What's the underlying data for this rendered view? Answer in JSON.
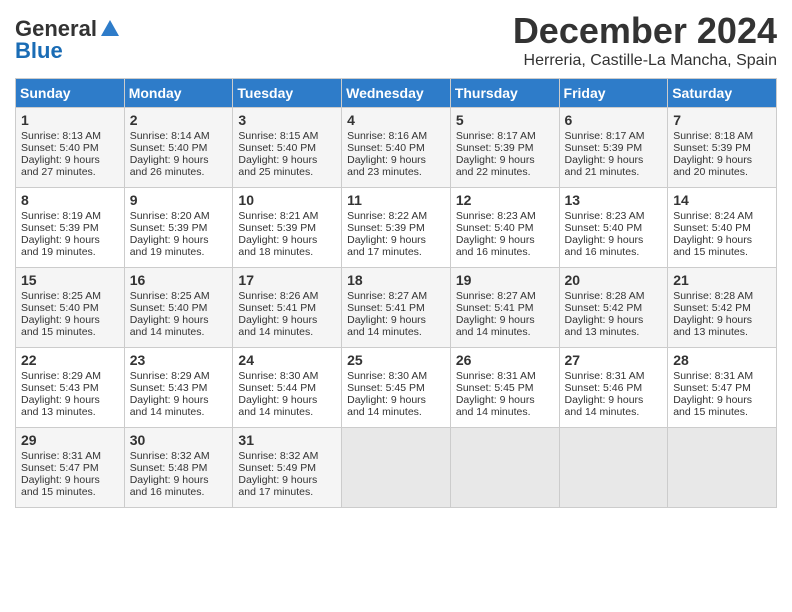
{
  "header": {
    "logo_general": "General",
    "logo_blue": "Blue",
    "title": "December 2024",
    "subtitle": "Herreria, Castille-La Mancha, Spain"
  },
  "columns": [
    "Sunday",
    "Monday",
    "Tuesday",
    "Wednesday",
    "Thursday",
    "Friday",
    "Saturday"
  ],
  "weeks": [
    [
      {
        "day": "1",
        "sunrise": "Sunrise: 8:13 AM",
        "sunset": "Sunset: 5:40 PM",
        "daylight": "Daylight: 9 hours and 27 minutes."
      },
      {
        "day": "2",
        "sunrise": "Sunrise: 8:14 AM",
        "sunset": "Sunset: 5:40 PM",
        "daylight": "Daylight: 9 hours and 26 minutes."
      },
      {
        "day": "3",
        "sunrise": "Sunrise: 8:15 AM",
        "sunset": "Sunset: 5:40 PM",
        "daylight": "Daylight: 9 hours and 25 minutes."
      },
      {
        "day": "4",
        "sunrise": "Sunrise: 8:16 AM",
        "sunset": "Sunset: 5:40 PM",
        "daylight": "Daylight: 9 hours and 23 minutes."
      },
      {
        "day": "5",
        "sunrise": "Sunrise: 8:17 AM",
        "sunset": "Sunset: 5:39 PM",
        "daylight": "Daylight: 9 hours and 22 minutes."
      },
      {
        "day": "6",
        "sunrise": "Sunrise: 8:17 AM",
        "sunset": "Sunset: 5:39 PM",
        "daylight": "Daylight: 9 hours and 21 minutes."
      },
      {
        "day": "7",
        "sunrise": "Sunrise: 8:18 AM",
        "sunset": "Sunset: 5:39 PM",
        "daylight": "Daylight: 9 hours and 20 minutes."
      }
    ],
    [
      {
        "day": "8",
        "sunrise": "Sunrise: 8:19 AM",
        "sunset": "Sunset: 5:39 PM",
        "daylight": "Daylight: 9 hours and 19 minutes."
      },
      {
        "day": "9",
        "sunrise": "Sunrise: 8:20 AM",
        "sunset": "Sunset: 5:39 PM",
        "daylight": "Daylight: 9 hours and 19 minutes."
      },
      {
        "day": "10",
        "sunrise": "Sunrise: 8:21 AM",
        "sunset": "Sunset: 5:39 PM",
        "daylight": "Daylight: 9 hours and 18 minutes."
      },
      {
        "day": "11",
        "sunrise": "Sunrise: 8:22 AM",
        "sunset": "Sunset: 5:39 PM",
        "daylight": "Daylight: 9 hours and 17 minutes."
      },
      {
        "day": "12",
        "sunrise": "Sunrise: 8:23 AM",
        "sunset": "Sunset: 5:40 PM",
        "daylight": "Daylight: 9 hours and 16 minutes."
      },
      {
        "day": "13",
        "sunrise": "Sunrise: 8:23 AM",
        "sunset": "Sunset: 5:40 PM",
        "daylight": "Daylight: 9 hours and 16 minutes."
      },
      {
        "day": "14",
        "sunrise": "Sunrise: 8:24 AM",
        "sunset": "Sunset: 5:40 PM",
        "daylight": "Daylight: 9 hours and 15 minutes."
      }
    ],
    [
      {
        "day": "15",
        "sunrise": "Sunrise: 8:25 AM",
        "sunset": "Sunset: 5:40 PM",
        "daylight": "Daylight: 9 hours and 15 minutes."
      },
      {
        "day": "16",
        "sunrise": "Sunrise: 8:25 AM",
        "sunset": "Sunset: 5:40 PM",
        "daylight": "Daylight: 9 hours and 14 minutes."
      },
      {
        "day": "17",
        "sunrise": "Sunrise: 8:26 AM",
        "sunset": "Sunset: 5:41 PM",
        "daylight": "Daylight: 9 hours and 14 minutes."
      },
      {
        "day": "18",
        "sunrise": "Sunrise: 8:27 AM",
        "sunset": "Sunset: 5:41 PM",
        "daylight": "Daylight: 9 hours and 14 minutes."
      },
      {
        "day": "19",
        "sunrise": "Sunrise: 8:27 AM",
        "sunset": "Sunset: 5:41 PM",
        "daylight": "Daylight: 9 hours and 14 minutes."
      },
      {
        "day": "20",
        "sunrise": "Sunrise: 8:28 AM",
        "sunset": "Sunset: 5:42 PM",
        "daylight": "Daylight: 9 hours and 13 minutes."
      },
      {
        "day": "21",
        "sunrise": "Sunrise: 8:28 AM",
        "sunset": "Sunset: 5:42 PM",
        "daylight": "Daylight: 9 hours and 13 minutes."
      }
    ],
    [
      {
        "day": "22",
        "sunrise": "Sunrise: 8:29 AM",
        "sunset": "Sunset: 5:43 PM",
        "daylight": "Daylight: 9 hours and 13 minutes."
      },
      {
        "day": "23",
        "sunrise": "Sunrise: 8:29 AM",
        "sunset": "Sunset: 5:43 PM",
        "daylight": "Daylight: 9 hours and 14 minutes."
      },
      {
        "day": "24",
        "sunrise": "Sunrise: 8:30 AM",
        "sunset": "Sunset: 5:44 PM",
        "daylight": "Daylight: 9 hours and 14 minutes."
      },
      {
        "day": "25",
        "sunrise": "Sunrise: 8:30 AM",
        "sunset": "Sunset: 5:45 PM",
        "daylight": "Daylight: 9 hours and 14 minutes."
      },
      {
        "day": "26",
        "sunrise": "Sunrise: 8:31 AM",
        "sunset": "Sunset: 5:45 PM",
        "daylight": "Daylight: 9 hours and 14 minutes."
      },
      {
        "day": "27",
        "sunrise": "Sunrise: 8:31 AM",
        "sunset": "Sunset: 5:46 PM",
        "daylight": "Daylight: 9 hours and 14 minutes."
      },
      {
        "day": "28",
        "sunrise": "Sunrise: 8:31 AM",
        "sunset": "Sunset: 5:47 PM",
        "daylight": "Daylight: 9 hours and 15 minutes."
      }
    ],
    [
      {
        "day": "29",
        "sunrise": "Sunrise: 8:31 AM",
        "sunset": "Sunset: 5:47 PM",
        "daylight": "Daylight: 9 hours and 15 minutes."
      },
      {
        "day": "30",
        "sunrise": "Sunrise: 8:32 AM",
        "sunset": "Sunset: 5:48 PM",
        "daylight": "Daylight: 9 hours and 16 minutes."
      },
      {
        "day": "31",
        "sunrise": "Sunrise: 8:32 AM",
        "sunset": "Sunset: 5:49 PM",
        "daylight": "Daylight: 9 hours and 17 minutes."
      },
      null,
      null,
      null,
      null
    ]
  ]
}
